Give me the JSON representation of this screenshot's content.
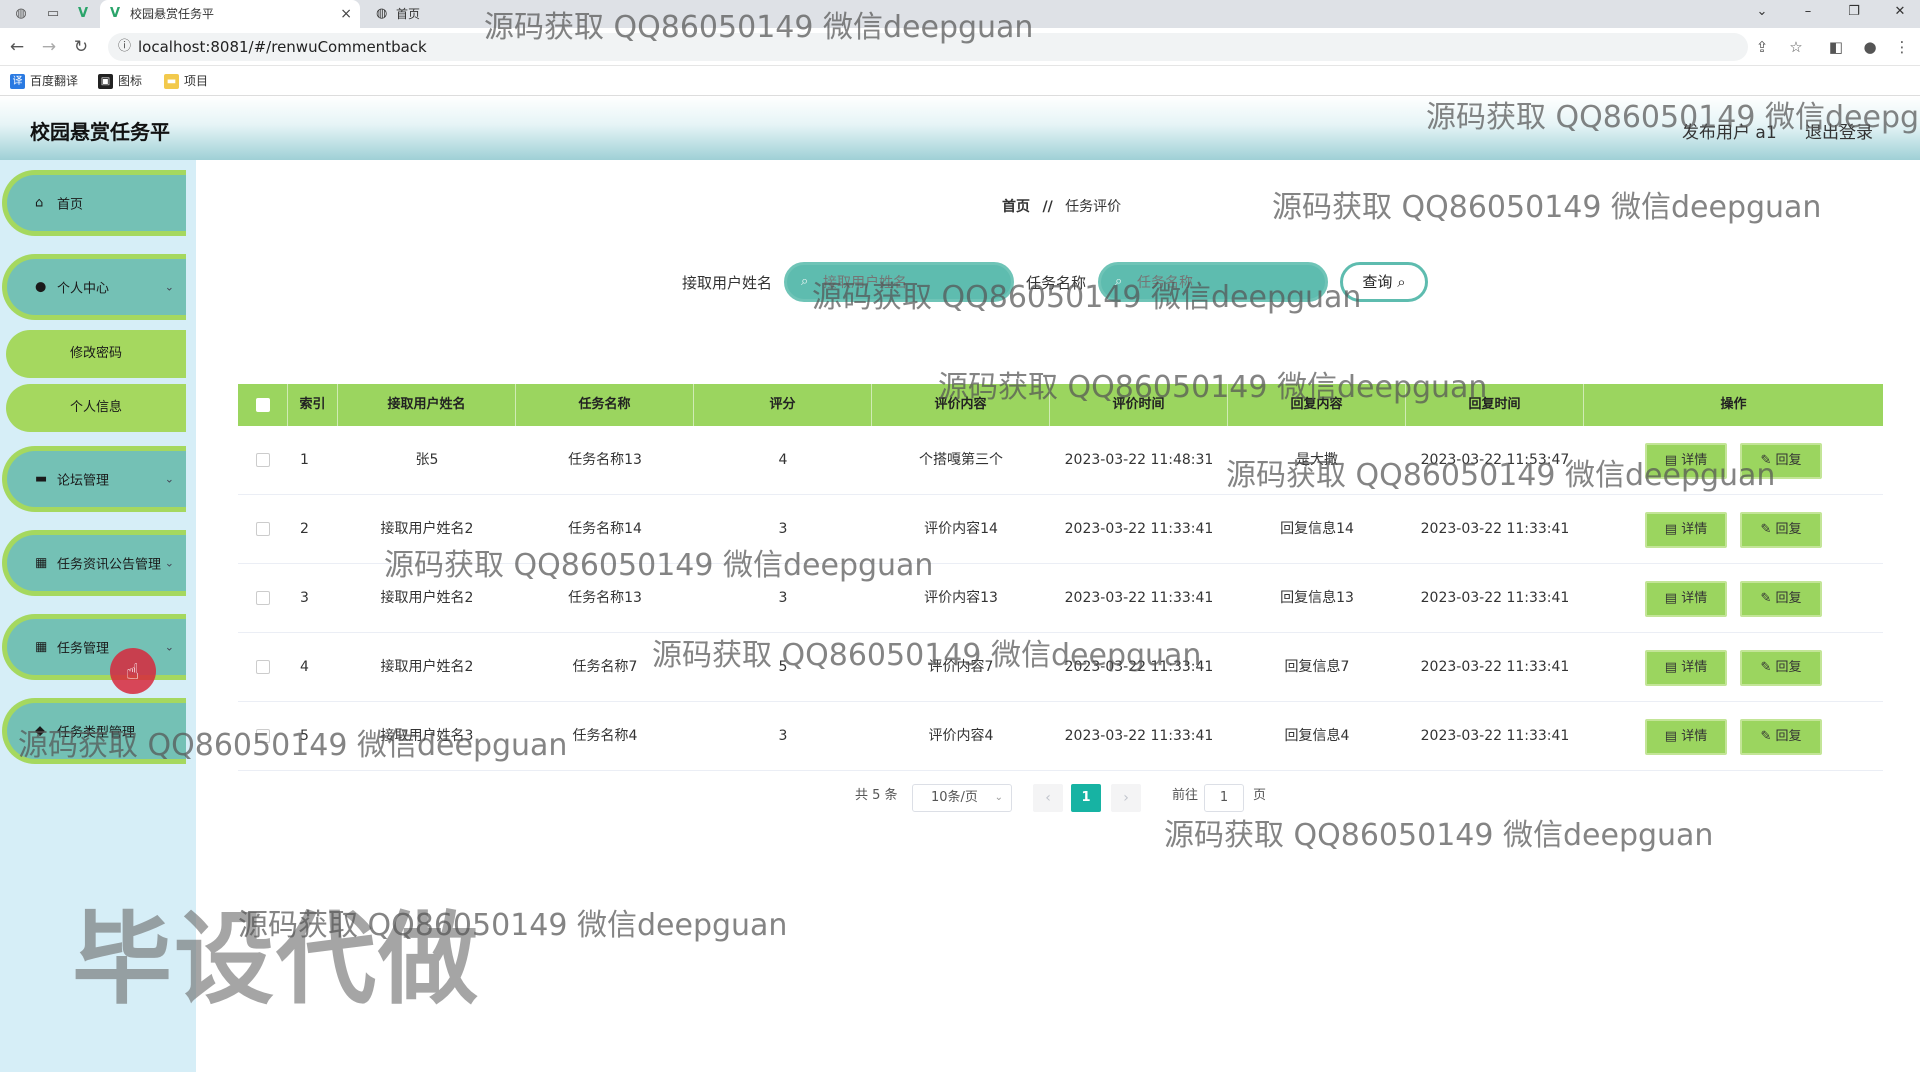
{
  "browser": {
    "tabs": [
      {
        "label": "校园悬赏任务平",
        "active": true
      },
      {
        "label": "首页",
        "active": false
      }
    ],
    "url": "localhost:8081/#/renwuCommentback",
    "bookmarks": [
      "百度翻译",
      "图标",
      "项目"
    ]
  },
  "header": {
    "title": "校园悬赏任务平",
    "user_label": "发布用户",
    "user_name": "a1",
    "logout": "退出登录"
  },
  "sidebar": {
    "items": [
      {
        "label": "首页",
        "icon": "home-icon",
        "has_children": false
      },
      {
        "label": "个人中心",
        "icon": "user-icon",
        "has_children": true
      },
      {
        "label": "修改密码",
        "sub": true
      },
      {
        "label": "个人信息",
        "sub": true
      },
      {
        "label": "论坛管理",
        "icon": "forum-icon",
        "has_children": true
      },
      {
        "label": "任务资讯公告管理",
        "icon": "grid-icon",
        "has_children": true
      },
      {
        "label": "任务管理",
        "icon": "grid-icon",
        "has_children": true
      },
      {
        "label": "任务类型管理",
        "icon": "tag-icon",
        "has_children": true
      }
    ]
  },
  "breadcrumb": {
    "home": "首页",
    "separator": "//",
    "current": "任务评价"
  },
  "search": {
    "field1_label": "接取用户姓名",
    "field1_placeholder": "接取用户姓名",
    "field2_label": "任务名称",
    "field2_placeholder": "任务名称",
    "button": "查询"
  },
  "table": {
    "headers": [
      "索引",
      "接取用户姓名",
      "任务名称",
      "评分",
      "评价内容",
      "评价时间",
      "回复内容",
      "回复时间",
      "操作"
    ],
    "rows": [
      {
        "index": "1",
        "user": "张5",
        "task": "任务名称13",
        "score": "4",
        "content": "个搭嘎第三个",
        "time": "2023-03-22 11:48:31",
        "reply": "是大撒",
        "reply_time": "2023-03-22 11:53:47"
      },
      {
        "index": "2",
        "user": "接取用户姓名2",
        "task": "任务名称14",
        "score": "3",
        "content": "评价内容14",
        "time": "2023-03-22 11:33:41",
        "reply": "回复信息14",
        "reply_time": "2023-03-22 11:33:41"
      },
      {
        "index": "3",
        "user": "接取用户姓名2",
        "task": "任务名称13",
        "score": "3",
        "content": "评价内容13",
        "time": "2023-03-22 11:33:41",
        "reply": "回复信息13",
        "reply_time": "2023-03-22 11:33:41"
      },
      {
        "index": "4",
        "user": "接取用户姓名2",
        "task": "任务名称7",
        "score": "5",
        "content": "评价内容7",
        "time": "2023-03-22 11:33:41",
        "reply": "回复信息7",
        "reply_time": "2023-03-22 11:33:41"
      },
      {
        "index": "5",
        "user": "接取用户姓名3",
        "task": "任务名称4",
        "score": "3",
        "content": "评价内容4",
        "time": "2023-03-22 11:33:41",
        "reply": "回复信息4",
        "reply_time": "2023-03-22 11:33:41"
      }
    ],
    "detail_label": "详情",
    "reply_label": "回复"
  },
  "pagination": {
    "total": "共 5 条",
    "page_size": "10条/页",
    "current_page": "1",
    "goto_label": "前往",
    "goto_value": "1",
    "page_suffix": "页"
  },
  "watermark": {
    "text": "源码获取 QQ86050149 微信deepguan",
    "big_text": "毕设代做"
  },
  "colors": {
    "header_teal": "#9fd0d6",
    "menu_teal": "#74c1b5",
    "accent_green": "#9bd55f",
    "pager_active": "#17b3a3",
    "sidebar_bg": "#d6eef7"
  }
}
